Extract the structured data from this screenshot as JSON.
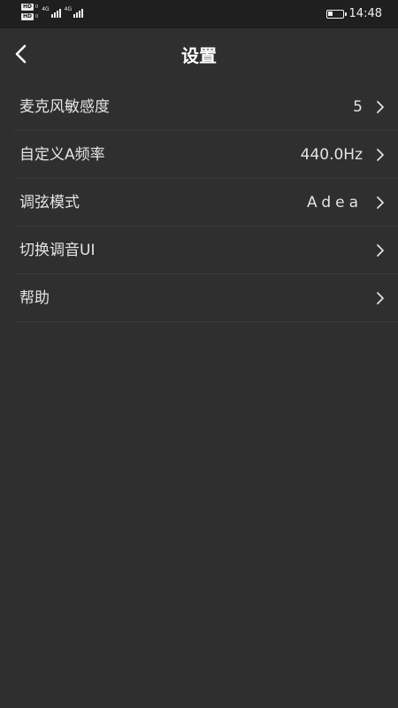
{
  "status_bar": {
    "hd_top": "HD",
    "hd_top_sub": "0",
    "hd_bottom": "HD",
    "hd_bottom_sub": "0",
    "network_1": "4G",
    "network_2": "4G",
    "time": "14:48",
    "battery_level": 0.3,
    "icons": [
      "hd-icon",
      "signal-icon",
      "battery-icon"
    ]
  },
  "header": {
    "title": "设置",
    "back_icon": "chevron-left-icon"
  },
  "settings": [
    {
      "label": "麦克风敏感度",
      "value": "5"
    },
    {
      "label": "自定义A频率",
      "value": "440.0Hz"
    },
    {
      "label": "调弦模式",
      "value": "Adea"
    },
    {
      "label": "切换调音UI",
      "value": ""
    },
    {
      "label": "帮助",
      "value": ""
    }
  ],
  "colors": {
    "background": "#2f2f2f",
    "status_bar": "#1f1f1f",
    "text": "#e4e4e4",
    "divider": "#3a3a3a"
  }
}
